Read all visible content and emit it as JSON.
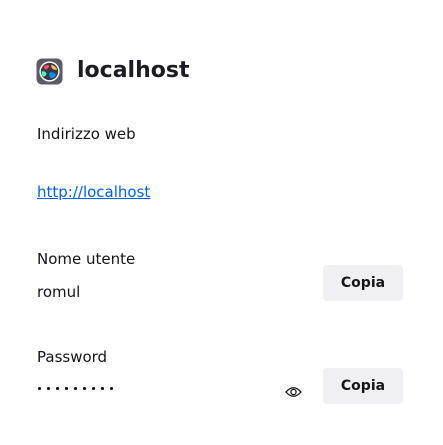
{
  "header": {
    "site_icon": "globe-favicon-icon",
    "title": "localhost"
  },
  "web_address": {
    "label": "Indirizzo web",
    "value": "http://localhost"
  },
  "username": {
    "label": "Nome utente",
    "value": "romul",
    "copy_label": "Copia"
  },
  "password": {
    "label": "Password",
    "masked_length": 9,
    "reveal_icon": "eye-icon",
    "copy_label": "Copia"
  },
  "colors": {
    "link": "#0060df",
    "button_bg": "#f0f0f4",
    "text": "#15141a"
  }
}
